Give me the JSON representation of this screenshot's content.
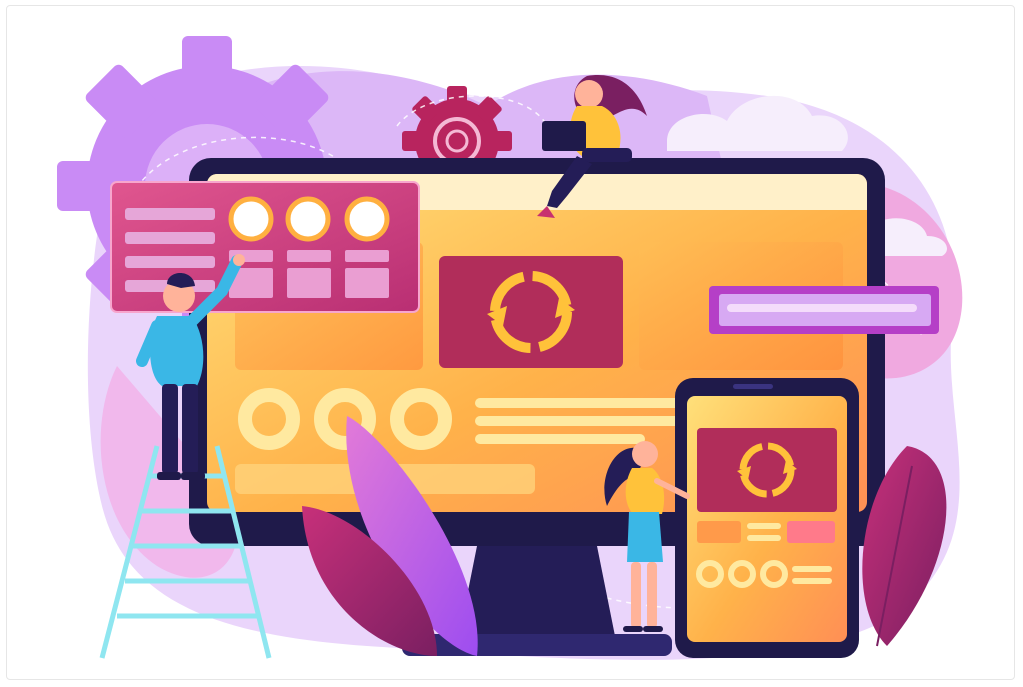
{
  "scene": {
    "subject": "web-development-illustration",
    "elements": [
      "gear-icon",
      "monitor",
      "tablet",
      "ladder",
      "laptop",
      "sync-icon",
      "leaf-decoration",
      "cloud-decoration"
    ],
    "palette": {
      "purple": "#b86ff0",
      "light_purple": "#d7a8f5",
      "magenta": "#c8306f",
      "deep_magenta": "#8e1f5c",
      "yellow": "#ffcc3a",
      "orange": "#ff8a2a",
      "navy": "#1f1a4a",
      "cyan": "#8fe6f0",
      "cloud": "#f3e9fb"
    }
  }
}
